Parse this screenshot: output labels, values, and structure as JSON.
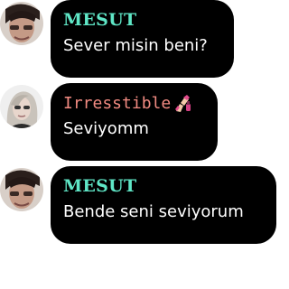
{
  "messages": [
    {
      "sender": "MESUT",
      "text": "Sever misin beni?",
      "name_color": "#5fe6c6",
      "avatar": "male-profile-avatar-icon"
    },
    {
      "sender": "Irresstible",
      "sender_emoji": "nail-polish-icon",
      "text": "Seviyomm",
      "name_color": "#f28b82",
      "avatar": "female-profile-avatar-icon"
    },
    {
      "sender": "MESUT",
      "text": "Bende seni seviyorum",
      "name_color": "#5fe6c6",
      "avatar": "male-profile-avatar-icon"
    }
  ]
}
